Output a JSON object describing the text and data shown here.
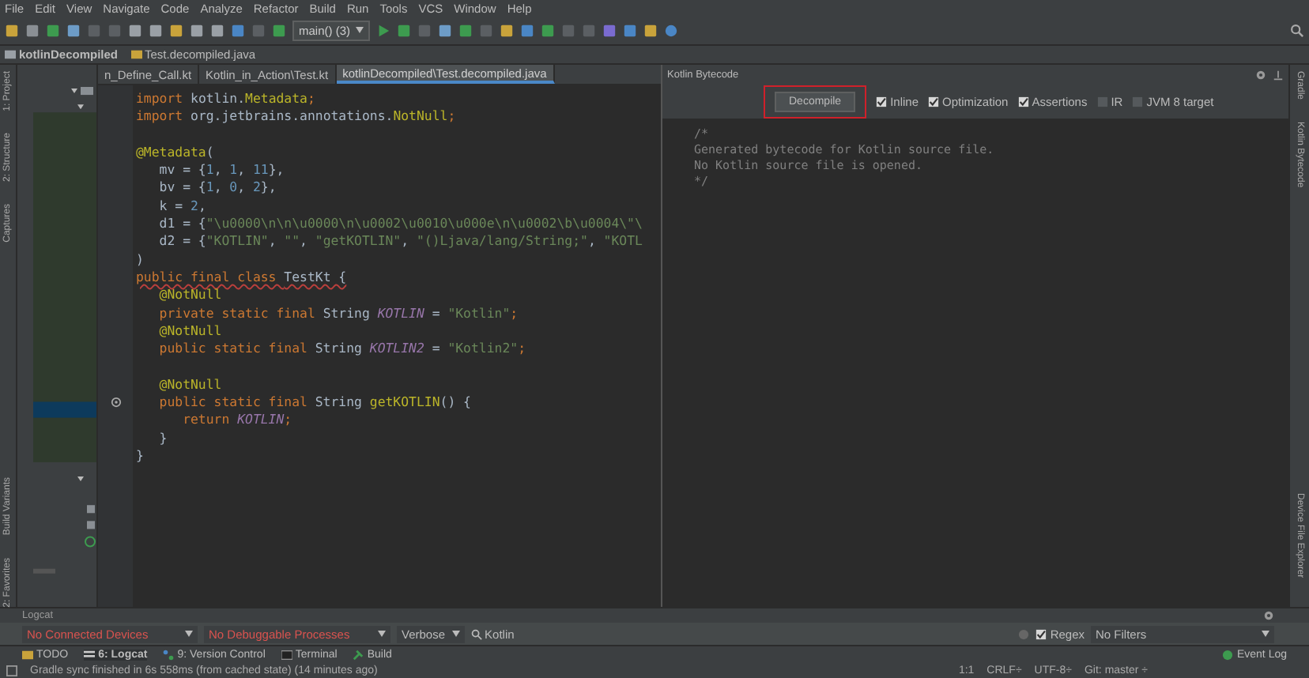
{
  "menu": [
    "File",
    "Edit",
    "View",
    "Navigate",
    "Code",
    "Analyze",
    "Refactor",
    "Build",
    "Run",
    "Tools",
    "VCS",
    "Window",
    "Help"
  ],
  "toolbar": {
    "run_config": "main() (3)"
  },
  "nav": [
    "kotlinDecompiled",
    "Test.decompiled.java"
  ],
  "left_tools": [
    "1: Project",
    "2: Structure",
    "Captures",
    "Build Variants",
    "2: Favorites"
  ],
  "right_tools": [
    "Gradle",
    "Kotlin Bytecode",
    "Device File Explorer"
  ],
  "editor": {
    "tabs": [
      {
        "label": "n_Define_Call.kt",
        "selected": false
      },
      {
        "label": "Kotlin_in_Action\\Test.kt",
        "selected": false
      },
      {
        "label": "kotlinDecompiled\\Test.decompiled.java",
        "selected": true
      }
    ],
    "blocks": [
      [
        {
          "tokens": [
            {
              "kind": "kw",
              "text": "import "
            },
            {
              "kind": "plain",
              "text": "kotlin."
            },
            {
              "kind": "ann",
              "text": "Metadata"
            },
            {
              "kind": "kw",
              "text": ";"
            }
          ]
        },
        {
          "tokens": [
            {
              "kind": "kw",
              "text": "import "
            },
            {
              "kind": "plain",
              "text": "org.jetbrains.annotations."
            },
            {
              "kind": "ann",
              "text": "NotNull"
            },
            {
              "kind": "kw",
              "text": ";"
            }
          ]
        }
      ],
      [
        {
          "tokens": [
            {
              "kind": "ann",
              "text": "@Metadata"
            },
            {
              "kind": "plain",
              "text": "("
            }
          ]
        },
        {
          "tokens": [
            {
              "kind": "plain",
              "text": "   mv = {"
            },
            {
              "kind": "num",
              "text": "1"
            },
            {
              "kind": "plain",
              "text": ", "
            },
            {
              "kind": "num",
              "text": "1"
            },
            {
              "kind": "plain",
              "text": ", "
            },
            {
              "kind": "num",
              "text": "11"
            },
            {
              "kind": "plain",
              "text": "},"
            }
          ]
        },
        {
          "tokens": [
            {
              "kind": "plain",
              "text": "   bv = {"
            },
            {
              "kind": "num",
              "text": "1"
            },
            {
              "kind": "plain",
              "text": ", "
            },
            {
              "kind": "num",
              "text": "0"
            },
            {
              "kind": "plain",
              "text": ", "
            },
            {
              "kind": "num",
              "text": "2"
            },
            {
              "kind": "plain",
              "text": "},"
            }
          ]
        },
        {
          "tokens": [
            {
              "kind": "plain",
              "text": "   k = "
            },
            {
              "kind": "num",
              "text": "2"
            },
            {
              "kind": "plain",
              "text": ","
            }
          ]
        },
        {
          "tokens": [
            {
              "kind": "plain",
              "text": "   d1 = {"
            },
            {
              "kind": "str",
              "text": "\"\\u0000\\n\\n\\u0000\\n\\u0002\\u0010\\u000e\\n\\u0002\\b\\u0004\\\"\\"
            }
          ]
        },
        {
          "tokens": [
            {
              "kind": "plain",
              "text": "   d2 = {"
            },
            {
              "kind": "str",
              "text": "\"KOTLIN\""
            },
            {
              "kind": "plain",
              "text": ", "
            },
            {
              "kind": "str",
              "text": "\"\""
            },
            {
              "kind": "plain",
              "text": ", "
            },
            {
              "kind": "str",
              "text": "\"getKOTLIN\""
            },
            {
              "kind": "plain",
              "text": ", "
            },
            {
              "kind": "str",
              "text": "\"()Ljava/lang/String;\""
            },
            {
              "kind": "plain",
              "text": ", "
            },
            {
              "kind": "str",
              "text": "\"KOTL"
            }
          ]
        },
        {
          "tokens": [
            {
              "kind": "plain",
              "text": ")"
            }
          ]
        },
        {
          "warning": true,
          "tokens": [
            {
              "kind": "kw",
              "text": "public final class "
            },
            {
              "kind": "plain",
              "text": "TestKt {"
            }
          ]
        },
        {
          "tokens": [
            {
              "kind": "ann",
              "text": "   @NotNull"
            }
          ]
        },
        {
          "tokens": [
            {
              "kind": "kw",
              "text": "   private static final "
            },
            {
              "kind": "plain",
              "text": "String "
            },
            {
              "kind": "field",
              "text": "KOTLIN"
            },
            {
              "kind": "plain",
              "text": " = "
            },
            {
              "kind": "str",
              "text": "\"Kotlin\""
            },
            {
              "kind": "kw",
              "text": ";"
            }
          ]
        },
        {
          "tokens": [
            {
              "kind": "ann",
              "text": "   @NotNull"
            }
          ]
        },
        {
          "tokens": [
            {
              "kind": "kw",
              "text": "   public static final "
            },
            {
              "kind": "plain",
              "text": "String "
            },
            {
              "kind": "field",
              "text": "KOTLIN2"
            },
            {
              "kind": "plain",
              "text": " = "
            },
            {
              "kind": "str",
              "text": "\"Kotlin2\""
            },
            {
              "kind": "kw",
              "text": ";"
            }
          ]
        }
      ],
      [
        {
          "tokens": [
            {
              "kind": "ann",
              "text": "   @NotNull"
            }
          ]
        },
        {
          "marker": true,
          "tokens": [
            {
              "kind": "kw",
              "text": "   public static final "
            },
            {
              "kind": "plain",
              "text": "String "
            },
            {
              "kind": "ann",
              "text": "getKOTLIN"
            },
            {
              "kind": "plain",
              "text": "() {"
            }
          ]
        },
        {
          "tokens": [
            {
              "kind": "kw",
              "text": "      return "
            },
            {
              "kind": "field",
              "text": "KOTLIN"
            },
            {
              "kind": "kw",
              "text": ";"
            }
          ]
        },
        {
          "tokens": [
            {
              "kind": "plain",
              "text": "   }"
            }
          ]
        },
        {
          "tokens": [
            {
              "kind": "plain",
              "text": "}"
            }
          ]
        }
      ]
    ]
  },
  "bytecode": {
    "title": "Kotlin Bytecode",
    "decompile": {
      "label": "Decompile",
      "highlighted": true
    },
    "options": [
      {
        "label": "Inline",
        "checked": true
      },
      {
        "label": "Optimization",
        "checked": true
      },
      {
        "label": "Assertions",
        "checked": true
      },
      {
        "label": "IR",
        "checked": false
      },
      {
        "label": "JVM 8 target",
        "checked": false
      }
    ],
    "text": [
      "/*",
      "Generated bytecode for Kotlin source file.",
      "No Kotlin source file is opened.",
      "*/"
    ]
  },
  "logcat": {
    "title": "Logcat",
    "device": "No Connected Devices",
    "process": "No Debuggable Processes",
    "log_level": "Verbose",
    "search": "Kotlin",
    "regex": {
      "label": "Regex",
      "checked": true
    },
    "filter": "No Filters"
  },
  "tool_tabs": [
    {
      "kind": "todo",
      "label": "TODO",
      "selected": false
    },
    {
      "kind": "logcat",
      "label": "6: Logcat",
      "selected": true
    },
    {
      "kind": "vcs",
      "label": "9: Version Control",
      "selected": false
    },
    {
      "kind": "terminal",
      "label": "Terminal",
      "selected": false
    },
    {
      "kind": "build",
      "label": "Build",
      "selected": false
    }
  ],
  "event_log": "Event Log",
  "status": {
    "message": "Gradle sync finished in 6s 558ms (from cached state) (14 minutes ago)",
    "position": "1:1",
    "line_separator": "CRLF÷",
    "encoding": "UTF-8÷",
    "vcs": "Git: master ÷"
  }
}
